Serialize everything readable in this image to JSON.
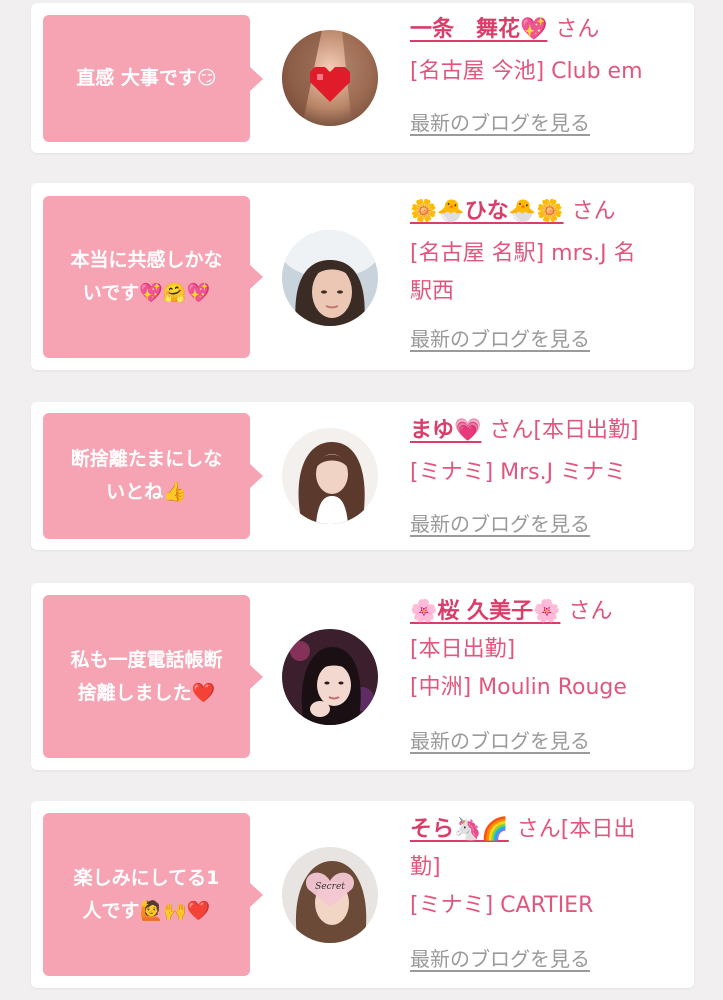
{
  "items": [
    {
      "comment_lines": [
        "直感 大事です😏"
      ],
      "name": "一条　舞花💖",
      "suffix": "さん",
      "detail_lines": [
        "[名古屋 今池] Club em"
      ],
      "blog_link": "最新のブログを見る",
      "avatar_icon": "portrait-heart-sticker-icon"
    },
    {
      "comment_lines": [
        "本当に共感しかな",
        "いです💖🤗💖"
      ],
      "name": "🌼🐣ひな🐣🌼",
      "suffix": "さん",
      "detail_lines": [
        "[名古屋 名駅] mrs.J 名",
        "駅西"
      ],
      "blog_link": "最新のブログを見る",
      "avatar_icon": "portrait-icon"
    },
    {
      "comment_lines": [
        "断捨離たまにしな",
        "いとね👍"
      ],
      "name": "まゆ💗",
      "suffix": "さん[本日出勤]",
      "detail_lines": [
        "[ミナミ] Mrs.J ミナミ"
      ],
      "blog_link": "最新のブログを見る",
      "avatar_icon": "portrait-icon"
    },
    {
      "comment_lines": [
        "私も一度電話帳断",
        "捨離しました❤️"
      ],
      "name": "🌸桜 久美子🌸",
      "suffix": "さん",
      "detail_lines": [
        "[本日出勤]",
        "[中洲] Moulin Rouge"
      ],
      "blog_link": "最新のブログを見る",
      "avatar_icon": "portrait-icon"
    },
    {
      "comment_lines": [
        "楽しみにしてる1",
        "人です🙋🙌❤️"
      ],
      "name": "そら🦄🌈",
      "suffix": "さん[本日出",
      "detail_lines": [
        "勤]",
        "[ミナミ] CARTIER"
      ],
      "blog_link": "最新のブログを見る",
      "avatar_icon": "portrait-secret-sticker-icon",
      "avatar_sticker": "Secret"
    }
  ],
  "colors": {
    "bubble": "#f6a3b4",
    "name": "#d93e6a",
    "detail": "#e0577e",
    "link": "#9a9a9a",
    "background": "#f1eff0"
  }
}
